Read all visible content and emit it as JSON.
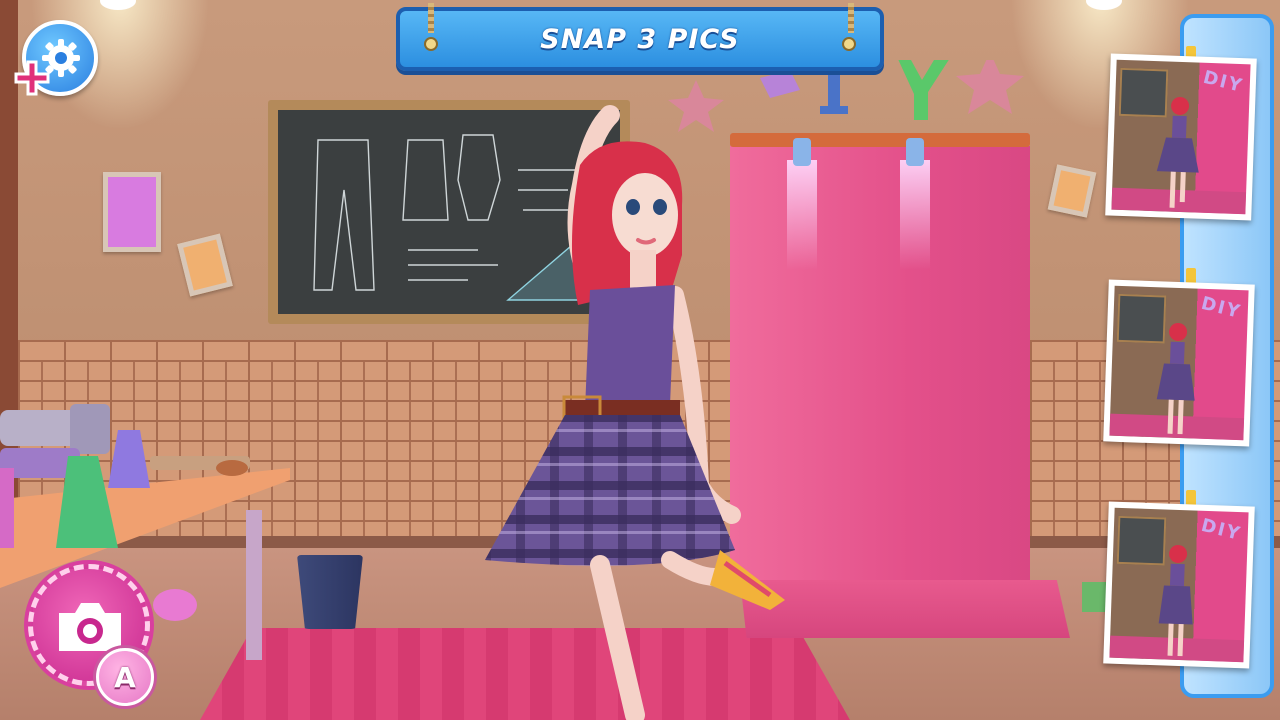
{
  "hud": {
    "title": "SNAP 3 PICS",
    "camera_hotkey": "A"
  },
  "photos": [
    {
      "logo": "DIY"
    },
    {
      "logo": "DIY"
    },
    {
      "logo": "DIY"
    }
  ],
  "icons": {
    "settings": "gear-icon",
    "add": "plus-icon",
    "camera": "camera-icon"
  },
  "colors": {
    "banner": "#2c8fe0",
    "camera_button": "#c8288e",
    "backdrop": "#e3508a",
    "photo_strip": "#8cc7f7"
  }
}
